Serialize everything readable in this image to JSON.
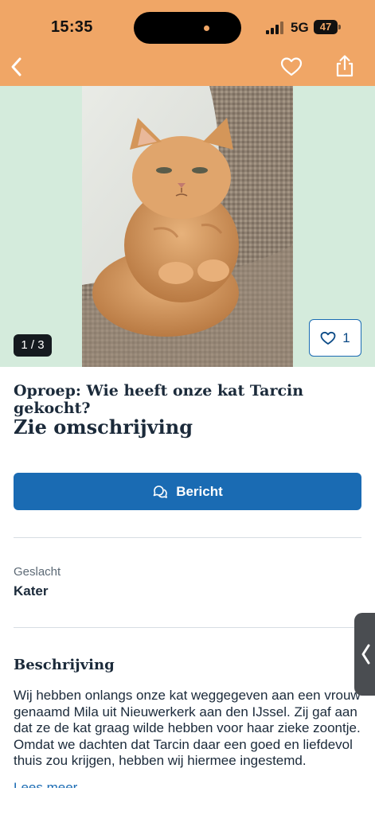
{
  "status_bar": {
    "time": "15:35",
    "network": "5G",
    "battery": "47"
  },
  "header": {
    "back_icon": "chevron-left-icon",
    "favorite_icon": "heart-outline-icon",
    "share_icon": "share-icon"
  },
  "gallery": {
    "counter": "1 / 3",
    "favorites_count": "1",
    "image": "orange-cat-on-chair-photo"
  },
  "listing": {
    "title": "Oproep: Wie heeft onze kat Tarcin gekocht?",
    "price": "Zie omschrijving",
    "message_button": "Bericht"
  },
  "attributes": [
    {
      "label": "Geslacht",
      "value": "Kater"
    }
  ],
  "description": {
    "heading": "Beschrijving",
    "text": "Wij hebben onlangs onze kat weggegeven aan een vrouw genaamd Mila uit Nieuwerkerk aan den IJssel. Zij gaf aan dat ze de kat graag wilde hebben voor haar zieke zoontje. Omdat we dachten dat Tarcin daar een goed en liefdevol thuis zou krijgen, hebben wij hiermee ingestemd.",
    "read_more": "Lees meer"
  },
  "colors": {
    "header_bg": "#f0a666",
    "photo_bg": "#d4ebdc",
    "accent": "#1a6bb3",
    "text": "#1b2a3a"
  }
}
